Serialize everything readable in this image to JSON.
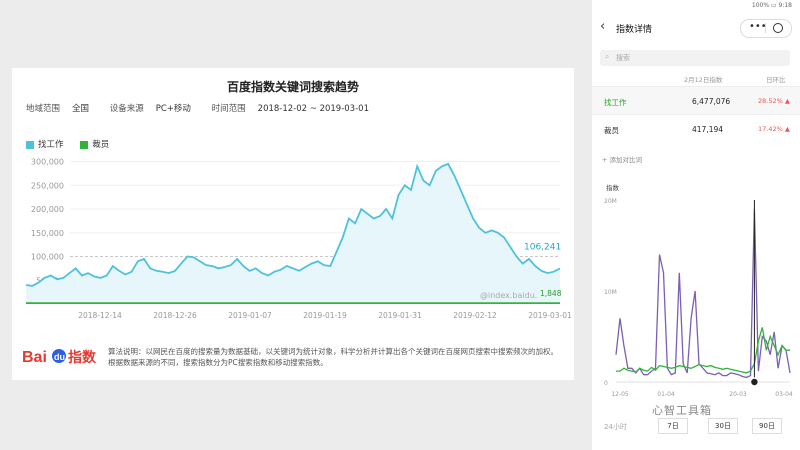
{
  "left_chart": {
    "title": "百度指数关键词搜索趋势",
    "meta": {
      "region_label": "地域范围",
      "region_value": "全国",
      "device_label": "设备来源",
      "device_value": "PC+移动",
      "time_label": "时间范围",
      "time_value": "2018-12-02 ~ 2019-03-01"
    },
    "legend": [
      {
        "name": "找工作",
        "color": "#4fc1dd"
      },
      {
        "name": "裁员",
        "color": "#32b33a"
      }
    ],
    "watermark": "@index.baidu.",
    "value_label_1": "106,241",
    "value_label_2": "1,848"
  },
  "chart_data": [
    {
      "type": "area",
      "title": "百度指数关键词搜索趋势",
      "x_ticks": [
        "2018-12-14",
        "2018-12-26",
        "2019-01-07",
        "2019-01-19",
        "2019-01-31",
        "2019-02-12",
        "2019-03-01"
      ],
      "y_ticks": [
        50000,
        100000,
        150000,
        200000,
        250000,
        300000
      ],
      "y_tick_labels": [
        "50,000",
        "100,000",
        "150,000",
        "200,000",
        "250,000",
        "300,000"
      ],
      "ylim": [
        0,
        320000
      ],
      "series": [
        {
          "name": "找工作",
          "color": "#4fc1dd",
          "values": [
            40000,
            38000,
            45000,
            55000,
            60000,
            52000,
            55000,
            65000,
            75000,
            60000,
            65000,
            58000,
            55000,
            60000,
            80000,
            70000,
            62000,
            68000,
            90000,
            95000,
            75000,
            70000,
            68000,
            65000,
            70000,
            85000,
            100000,
            98000,
            90000,
            82000,
            80000,
            75000,
            78000,
            82000,
            95000,
            80000,
            70000,
            75000,
            65000,
            60000,
            68000,
            72000,
            80000,
            75000,
            70000,
            78000,
            85000,
            90000,
            82000,
            80000,
            110000,
            140000,
            180000,
            170000,
            200000,
            190000,
            180000,
            185000,
            200000,
            180000,
            230000,
            250000,
            240000,
            290000,
            260000,
            250000,
            280000,
            290000,
            295000,
            270000,
            240000,
            210000,
            180000,
            160000,
            150000,
            155000,
            150000,
            140000,
            120000,
            100000,
            85000,
            95000,
            80000,
            70000,
            65000,
            68000,
            75000
          ]
        },
        {
          "name": "裁员",
          "color": "#32b33a",
          "values": [
            2000,
            2000,
            2000,
            2000,
            2000,
            2000,
            2000,
            2000,
            2000,
            2000,
            2000,
            2000,
            2000,
            2000,
            2000,
            2000,
            2000,
            2000,
            2000,
            2000,
            2000,
            2000,
            2000,
            2000,
            2000,
            2000,
            2000,
            2000,
            2000,
            2000,
            2000,
            2000,
            2000,
            2000,
            2000,
            2000,
            2000,
            2000,
            2000,
            2000,
            2000,
            2000,
            2000,
            2000,
            2000,
            2000,
            2000,
            2000,
            2000,
            2000,
            2000,
            2000,
            2000,
            2000,
            2000,
            2000,
            2000,
            2000,
            2000,
            2000,
            2000,
            2000,
            2000,
            2000,
            2000,
            2000,
            2000,
            2000,
            2000,
            2000,
            2000,
            2000,
            2000,
            2000,
            2000,
            2000,
            2000,
            2000,
            2000,
            2000,
            2000,
            2000,
            2000,
            2000,
            2000,
            2000,
            2000
          ]
        }
      ]
    },
    {
      "type": "line",
      "x_ticks": [
        "12-05",
        "01-04",
        "20-03",
        "03-04"
      ],
      "y_tick_labels": [
        "20M",
        "10M",
        "0"
      ],
      "ylim": [
        0,
        20000000
      ],
      "series": [
        {
          "name": "找工作",
          "color": "#7a5fb5",
          "values": [
            3000000,
            7000000,
            4000000,
            1500000,
            1500000,
            1000000,
            1500000,
            800000,
            800000,
            1200000,
            1500000,
            14000000,
            12000000,
            1500000,
            800000,
            1000000,
            12000000,
            2000000,
            1000000,
            7000000,
            10000000,
            2000000,
            1500000,
            1000000,
            900000,
            800000,
            1000000,
            700000,
            700000,
            1000000,
            900000,
            800000,
            600000,
            500000,
            700000,
            19000000,
            1200000,
            5000000,
            4500000,
            3000000,
            5500000,
            1500000,
            4000000,
            3500000,
            1000000
          ]
        },
        {
          "name": "裁员",
          "color": "#32b33a",
          "values": [
            1200000,
            1200000,
            1500000,
            1300000,
            1200000,
            1100000,
            1500000,
            1300000,
            1200000,
            1600000,
            1300000,
            1800000,
            1700000,
            1600000,
            1500000,
            1600000,
            1800000,
            1700000,
            1600000,
            1500000,
            1700000,
            1900000,
            1800000,
            1700000,
            1800000,
            1600000,
            1500000,
            1400000,
            1500000,
            1400000,
            1300000,
            1200000,
            1100000,
            1000000,
            1200000,
            2000000,
            4500000,
            6000000,
            3500000,
            5000000,
            4000000,
            3000000,
            4000000,
            3500000,
            3500000
          ]
        }
      ]
    }
  ],
  "footer": {
    "logo": "Bai du 指数",
    "text": "算法说明：以网民在百度的搜索量为数据基础，以关键词为统计对象，科学分析并计算出各个关键词在百度网页搜索中搜索频次的加权。根据数据来源的不同，搜索指数分为PC搜索指数和移动搜索指数。"
  },
  "phone": {
    "status": "100% ▭ 9:18",
    "nav_title": "指数详情",
    "search_placeholder": "搜索",
    "table_header": {
      "col2": "2月12日指数",
      "col3": "日环比"
    },
    "rows": [
      {
        "name": "找工作",
        "value": "6,477,076",
        "change": "28.52% ▲"
      },
      {
        "name": "裁员",
        "value": "417,194",
        "change": "17.42% ▲"
      }
    ],
    "add_compare": "+ 添加对比词",
    "chart_label": "指数",
    "range_start": "24小时",
    "ranges": [
      "7日",
      "30日",
      "90日"
    ]
  },
  "watermark": "心智工具箱"
}
